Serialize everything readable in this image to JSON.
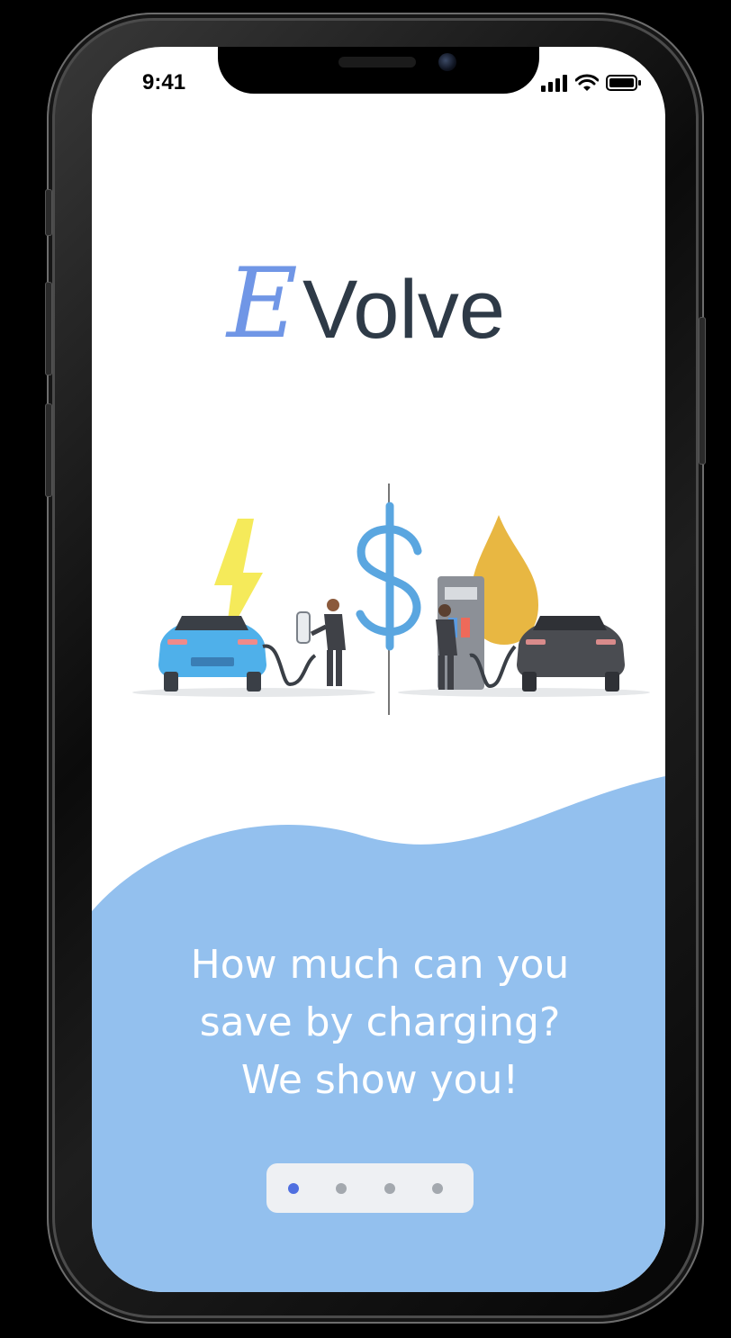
{
  "status_bar": {
    "time": "9:41",
    "icons": [
      "cellular-signal-icon",
      "wifi-icon",
      "battery-icon"
    ]
  },
  "app": {
    "logo_mark": "E",
    "logo_text": "Volve",
    "brand_color": "#7096e6",
    "text_color": "#2e3a47",
    "wave_color": "#93c0ee"
  },
  "onboarding": {
    "headline_lines": [
      "How much can you",
      "save by charging?",
      "We show you!"
    ],
    "illustration": "ev-charging-vs-gas-station-illustration",
    "pager": {
      "total": 4,
      "active_index": 0
    }
  }
}
